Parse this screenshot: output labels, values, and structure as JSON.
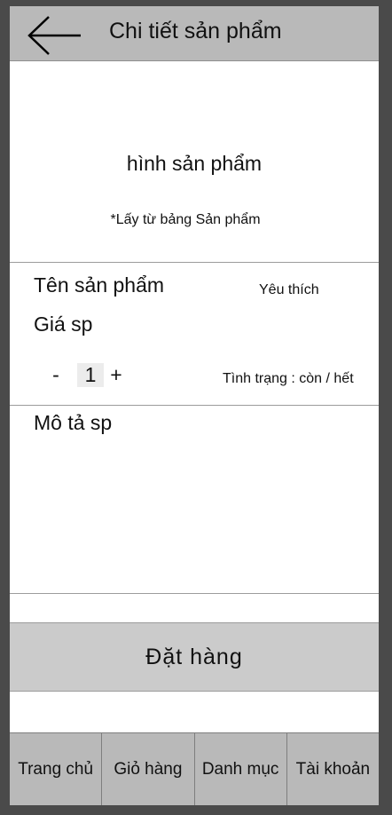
{
  "header": {
    "title": "Chi tiết sản phẩm",
    "back_icon": "arrow-left-icon"
  },
  "image_area": {
    "label": "hình sản phẩm",
    "note": "*Lấy từ bảng Sản phẩm"
  },
  "product": {
    "name": "Tên sản phẩm",
    "favorite_label": "Yêu thích",
    "price": "Giá sp",
    "quantity": {
      "minus": "-",
      "value": "1",
      "plus": "+"
    },
    "status": "Tình trạng : còn / hết"
  },
  "description": {
    "label": "Mô tả sp"
  },
  "order_button": "Đặt hàng",
  "tabs": [
    {
      "label": "Trang chủ"
    },
    {
      "label": "Giỏ hàng"
    },
    {
      "label": "Danh mục"
    },
    {
      "label": "Tài khoản"
    }
  ],
  "colors": {
    "frame_background": "#4a4a4a",
    "bar_gray": "#b9b9b9",
    "button_gray": "#cbcbcb"
  }
}
